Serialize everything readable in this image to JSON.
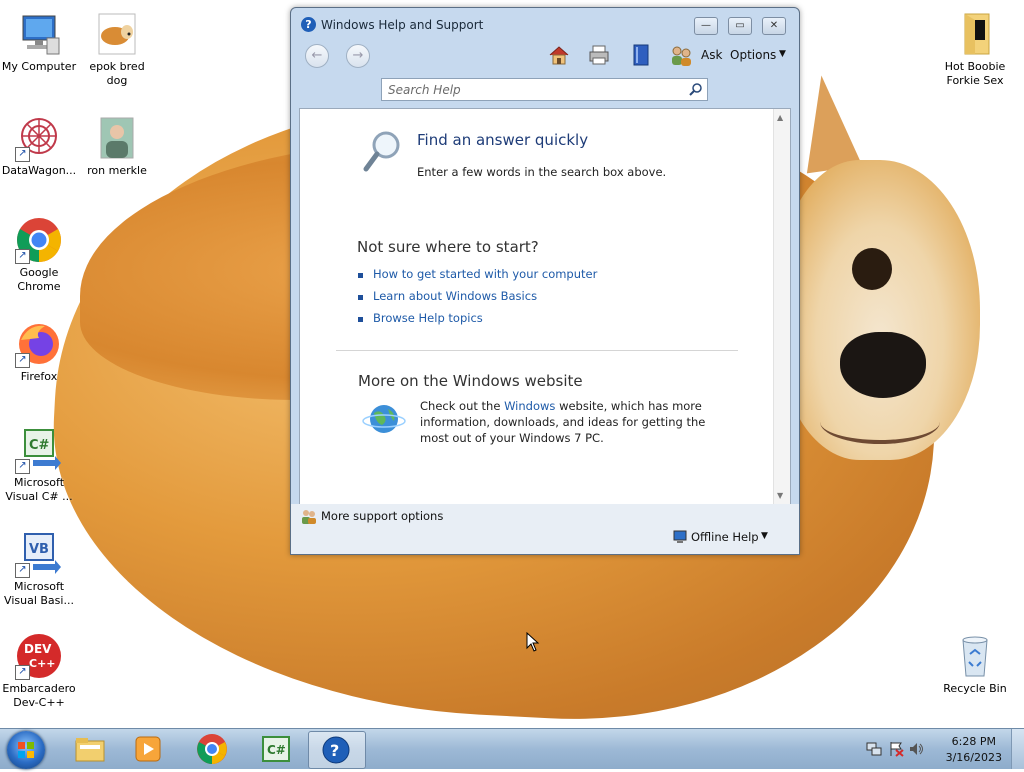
{
  "desktop": {
    "icons": [
      {
        "label": "My Computer"
      },
      {
        "label": "epok bred dog"
      },
      {
        "label": "DataWagon..."
      },
      {
        "label": "ron merkle"
      },
      {
        "label": "Google Chrome"
      },
      {
        "label": "Firefox"
      },
      {
        "label": "Microsoft Visual C# ..."
      },
      {
        "label": "Microsoft Visual Basi..."
      },
      {
        "label": "Embarcadero Dev-C++"
      },
      {
        "label": "Hot Boobie Forkie Sex"
      },
      {
        "label": "Recycle Bin"
      }
    ]
  },
  "window": {
    "title": "Windows Help and Support",
    "toolbar": {
      "ask": "Ask",
      "options": "Options"
    },
    "search": {
      "placeholder": "Search Help"
    },
    "find": {
      "heading": "Find an answer quickly",
      "desc": "Enter a few words in the search box above."
    },
    "start": {
      "heading": "Not sure where to start?",
      "links": [
        "How to get started with your computer",
        "Learn about Windows Basics",
        "Browse Help topics"
      ]
    },
    "website": {
      "heading": "More on the Windows website",
      "text_before": "Check out the",
      "link": "Windows",
      "text_after": "website, which has more information, downloads, and ideas for getting the most out of your Windows 7 PC."
    },
    "footer": {
      "more_support": "More support options",
      "offline": "Offline Help"
    }
  },
  "taskbar": {
    "clock": {
      "time": "6:28 PM",
      "date": "3/16/2023"
    }
  }
}
